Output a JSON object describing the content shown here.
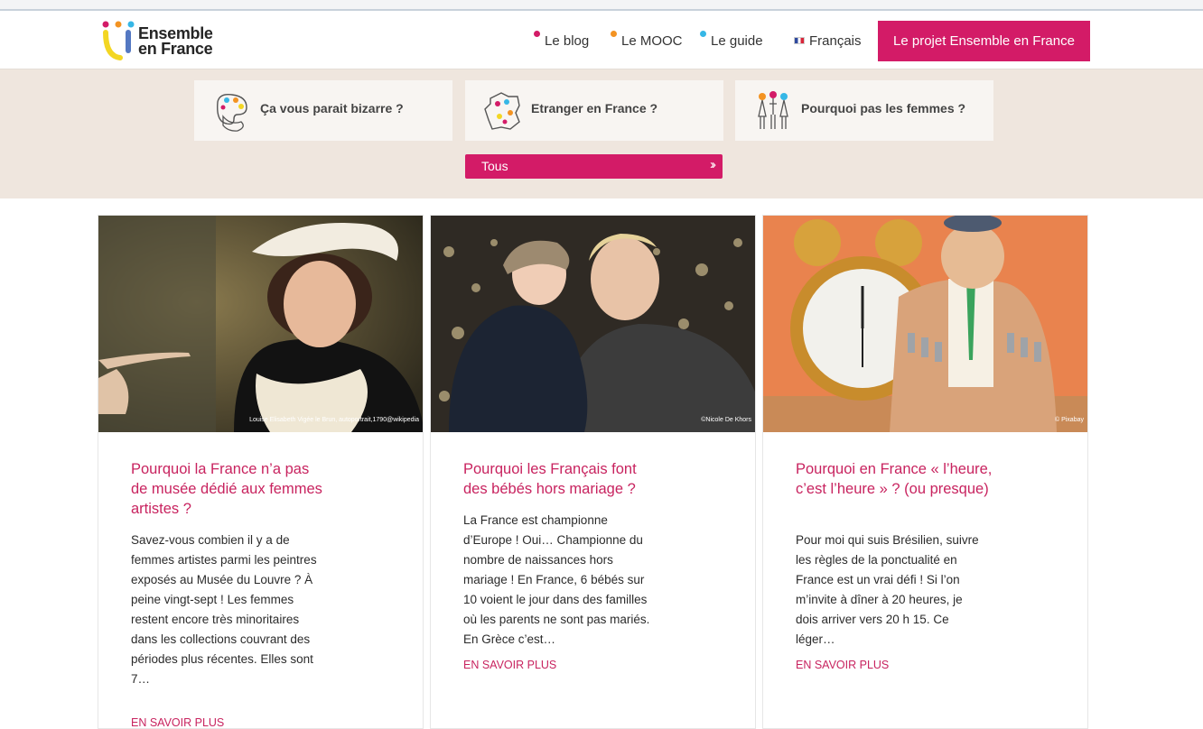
{
  "brand": {
    "name_line1": "Ensemble",
    "name_line2": "en France",
    "accent": "#d31b67"
  },
  "nav": {
    "items": [
      {
        "label": "Le blog",
        "dot_color": "#d31b67"
      },
      {
        "label": "Le MOOC",
        "dot_color": "#f39322"
      },
      {
        "label": "Le guide",
        "dot_color": "#36b7e6"
      }
    ],
    "language": "Français",
    "cta": "Le projet Ensemble en France"
  },
  "categories": [
    {
      "label": "Ça vous parait bizarre ?"
    },
    {
      "label": "Etranger en France ?"
    },
    {
      "label": "Pourquoi pas les femmes ?"
    }
  ],
  "all_button": {
    "label": "Tous",
    "icon": "double-chevron-right-icon"
  },
  "articles": [
    {
      "title": "Pourquoi la France n’a pas de musée dédié aux femmes artistes ?",
      "excerpt": "Savez-vous combien il y a de femmes artistes parmi les peintres exposés au Musée du Louvre ? À peine vingt-sept ! Les femmes restent encore très minoritaires dans les collections couvrant des périodes plus récentes. Elles sont 7…",
      "credit": "Louise Elisabeth Vigée le Brun, autoportrait,1790@wikipedia",
      "more": "EN SAVOIR PLUS"
    },
    {
      "title": "Pourquoi les Français font des bébés hors mariage ?",
      "excerpt": "La France est championne d’Europe ! Oui… Championne du nombre de naissances hors mariage ! En France, 6 bébés sur 10 voient le jour dans des familles où les parents ne sont pas mariés. En Grèce c’est…",
      "credit": "©Nicole De Khors",
      "more": "EN SAVOIR PLUS"
    },
    {
      "title": "Pourquoi en France « l’heure, c’est l’heure » ? (ou presque)",
      "excerpt": "Pour moi qui suis Brésilien, suivre les règles de la ponctualité en France est un vrai défi ! Si l’on m’invite à dîner à 20 heures, je dois arriver vers 20 h 15. Ce léger…",
      "credit": "© Pixabay",
      "more": "EN SAVOIR PLUS"
    }
  ]
}
